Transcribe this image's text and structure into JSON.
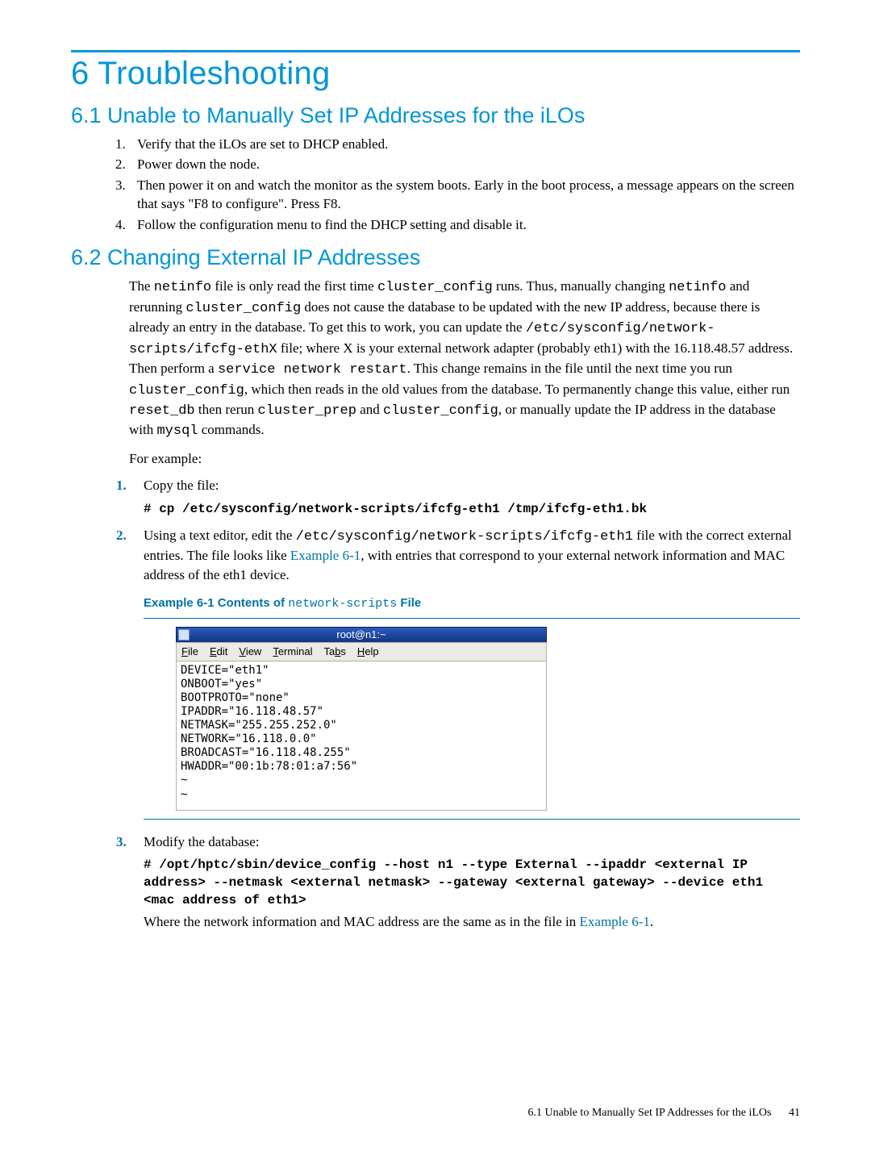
{
  "chapter_title": "6 Troubleshooting",
  "section_6_1": {
    "title": "6.1 Unable to Manually Set IP Addresses for the iLOs",
    "steps": [
      "Verify that the iLOs are set to DHCP enabled.",
      "Power down the node.",
      "Then power it on and watch the monitor as the system boots. Early in the boot process, a message appears on the screen that says \"F8 to configure\". Press F8.",
      "Follow the configuration menu to find the DHCP setting and disable it."
    ]
  },
  "section_6_2": {
    "title": "6.2 Changing External IP Addresses",
    "para_parts": {
      "t0": "The ",
      "c0": "netinfo",
      "t1": " file is only read the first time ",
      "c1": "cluster_config",
      "t2": " runs. Thus, manually changing ",
      "c2": "netinfo",
      "t3": " and rerunning ",
      "c3": "cluster_config",
      "t4": " does not cause the database to be updated with the new IP address, because there is already an entry in the database. To get this to work, you can update the ",
      "c4": "/etc/sysconfig/network-scripts/ifcfg-ethX",
      "t5": " file; where X is your external network adapter (probably eth1) with the 16.118.48.57 address. Then perform a ",
      "c5": "service network restart",
      "t6": ". This change remains in the file until the next time you run ",
      "c6": "cluster_config",
      "t7": ", which then reads in the old values from the database. To permanently change this value, either run ",
      "c7": "reset_db",
      "t8": " then rerun ",
      "c8": "cluster_prep",
      "t9": " and ",
      "c9": "cluster_config",
      "t10": ", or manually update the IP address in the database with ",
      "c10": "mysql",
      "t11": " commands."
    },
    "for_example": "For example:",
    "step1_text": "Copy the file:",
    "step1_cmd_prefix": "# ",
    "step1_cmd": "cp /etc/sysconfig/network-scripts/ifcfg-eth1 /tmp/ifcfg-eth1.bk",
    "step2_parts": {
      "t0": "Using a text editor, edit the ",
      "c0": "/etc/sysconfig/network-scripts/ifcfg-eth1",
      "t1": " file with the correct external entries. The file looks like ",
      "link0": "Example 6-1",
      "t2": ", with entries that correspond to your external network information and MAC address of the eth1 device."
    },
    "example_title_parts": {
      "t0": "Example 6-1 Contents of ",
      "c0": "network-scripts",
      "t1": " File"
    },
    "terminal": {
      "title": "root@n1:~",
      "menu": {
        "file": "File",
        "edit": "Edit",
        "view": "View",
        "terminal": "Terminal",
        "tabs": "Tabs",
        "help": "Help"
      },
      "content": "DEVICE=\"eth1\"\nONBOOT=\"yes\"\nBOOTPROTO=\"none\"\nIPADDR=\"16.118.48.57\"\nNETMASK=\"255.255.252.0\"\nNETWORK=\"16.118.0.0\"\nBROADCAST=\"16.118.48.255\"\nHWADDR=\"00:1b:78:01:a7:56\"\n~\n~"
    },
    "step3_text": "Modify the database:",
    "step3_cmd_prefix": "# ",
    "step3_cmd": "/opt/hptc/sbin/device_config --host n1 --type External --ipaddr <external IP address> --netmask <external netmask> --gateway <external gateway> --device eth1 <mac address of eth1>",
    "step3_tail_parts": {
      "t0": "Where the network information and MAC address are the same as in the file in ",
      "link0": "Example 6-1",
      "t1": "."
    }
  },
  "footer": {
    "text": "6.1 Unable to Manually Set IP Addresses for the iLOs",
    "page": "41"
  }
}
